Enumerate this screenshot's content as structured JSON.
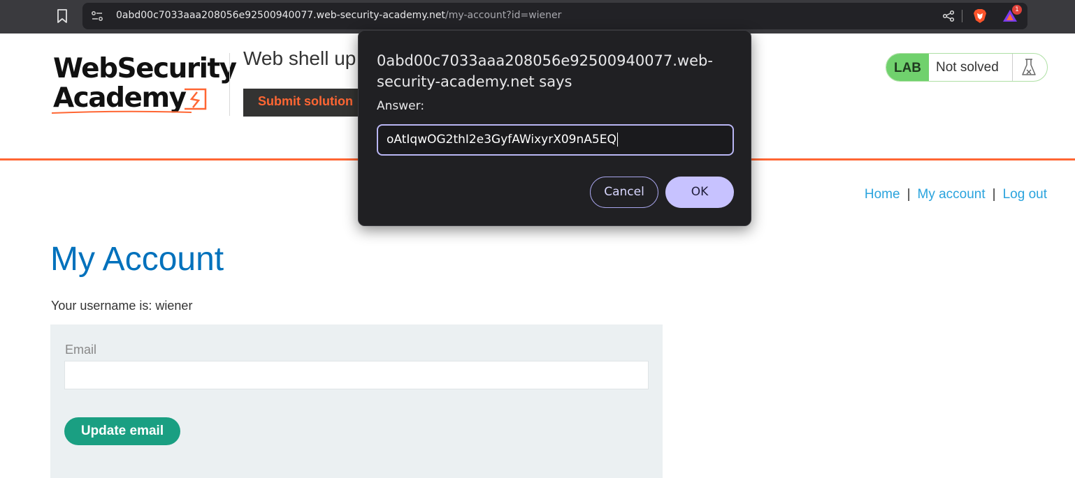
{
  "browser": {
    "url_host": "0abd00c7033aaa208056e92500940077.web-security-academy.net",
    "url_path": "/my-account?id=wiener",
    "rewards_badge_count": "1",
    "icons": [
      "bookmark-icon",
      "site-info-icon",
      "share-icon",
      "brave-shield-icon",
      "brave-rewards-icon"
    ]
  },
  "header": {
    "logo_line1": "WebSecurity",
    "logo_line2": "Academy",
    "lab_title": "Web shell up",
    "submit_label": "Submit solution",
    "lab_tag": "LAB",
    "lab_status": "Not solved",
    "accent_color": "#ff6633"
  },
  "nav": {
    "home": "Home",
    "my_account": "My account",
    "log_out": "Log out",
    "separator": "|"
  },
  "main": {
    "title": "My Account",
    "username_line": "Your username is: wiener",
    "email_label": "Email",
    "email_value": "",
    "update_label": "Update email"
  },
  "dialog": {
    "origin": "0abd00c7033aaa208056e92500940077.web-security-academy.net says",
    "label": "Answer:",
    "value": "oAtIqwOG2thI2e3GyfAWixyrX09nA5EQ",
    "cancel_label": "Cancel",
    "ok_label": "OK"
  }
}
